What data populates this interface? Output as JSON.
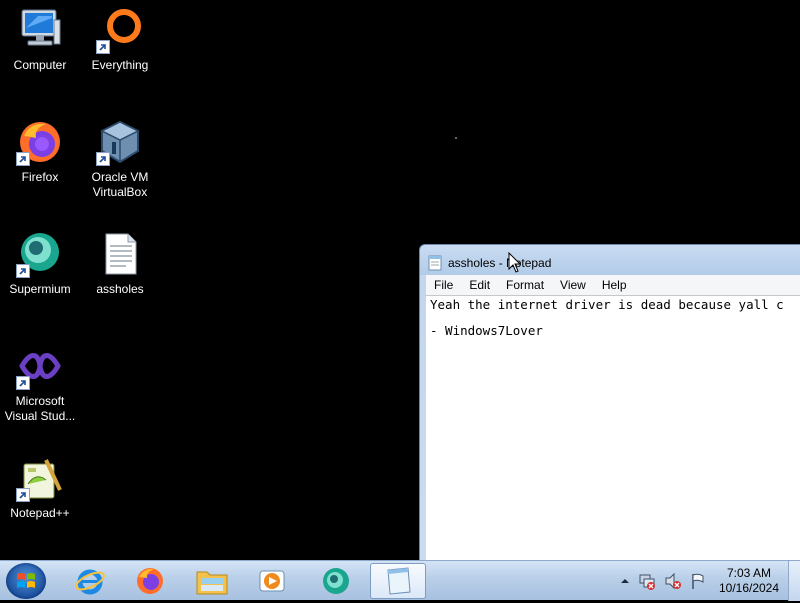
{
  "desktop_icons": [
    {
      "label": "Computer",
      "icon": "computer-icon"
    },
    {
      "label": "Everything",
      "icon": "everything-icon"
    },
    {
      "label": "Firefox",
      "icon": "firefox-icon"
    },
    {
      "label": "Oracle VM VirtualBox",
      "icon": "virtualbox-icon"
    },
    {
      "label": "Supermium",
      "icon": "supermium-icon"
    },
    {
      "label": "assholes",
      "icon": "text-file-icon"
    },
    {
      "label": "Microsoft Visual Stud...",
      "icon": "visual-studio-icon"
    },
    {
      "label": "Notepad++",
      "icon": "notepadpp-icon"
    }
  ],
  "notepad": {
    "title": "assholes - Notepad",
    "menu": [
      "File",
      "Edit",
      "Format",
      "View",
      "Help"
    ],
    "lines": [
      "Yeah the internet driver is dead because yall c",
      "",
      "- Windows7Lover"
    ]
  },
  "taskbar": {
    "pinned": [
      "start-orb",
      "internet-explorer-icon",
      "firefox-icon",
      "file-explorer-icon",
      "media-player-icon",
      "supermium-icon",
      "notepad-icon"
    ],
    "active": "notepad-icon",
    "tray_icons": [
      "show-hidden-icons-arrow",
      "network-icon",
      "volume-muted-icon",
      "action-center-flag-icon"
    ],
    "time": "7:03 AM",
    "date": "10/16/2024"
  },
  "colors": {
    "desktop_background": "#000000",
    "taskbar": "#b9cfe8",
    "window_frame": "#c2d6ee"
  }
}
